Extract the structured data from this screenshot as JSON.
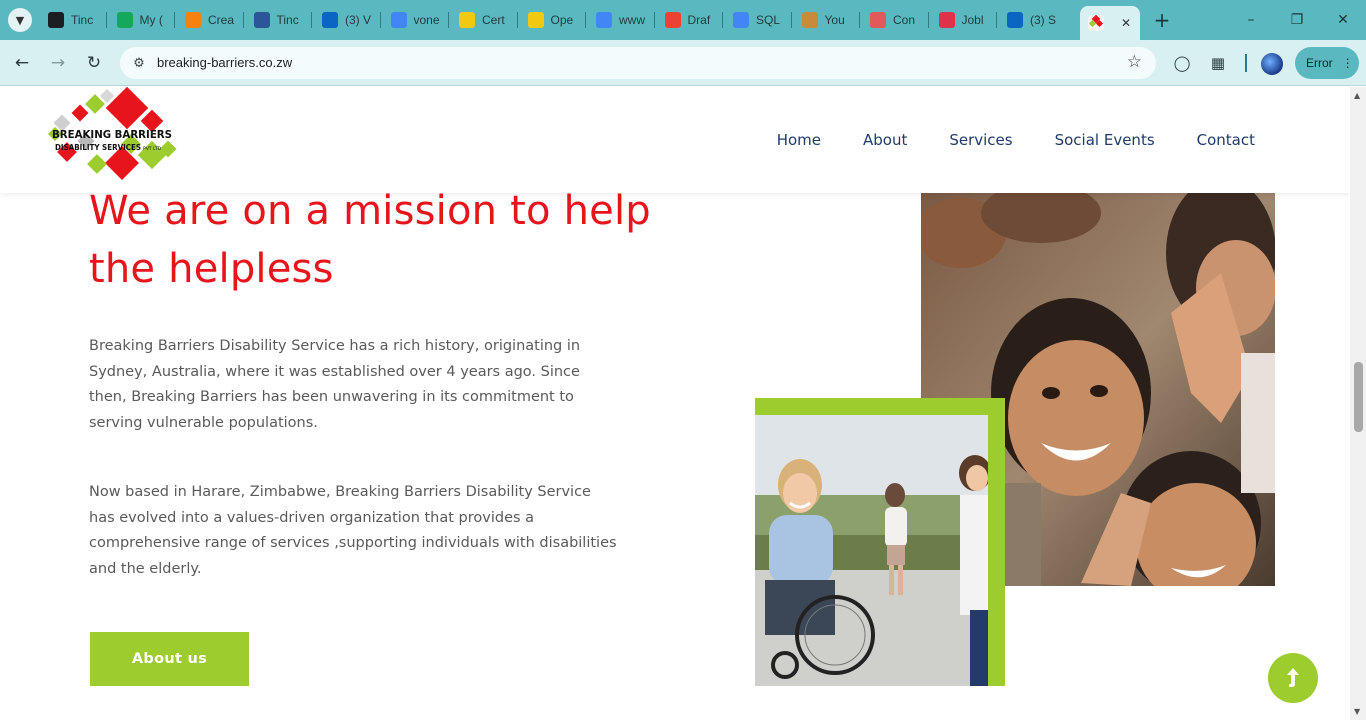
{
  "browser": {
    "tabs": [
      {
        "label": "Tinc",
        "icon": "github-icon",
        "color": "#1b1f23"
      },
      {
        "label": "My (",
        "icon": "grammarly-icon",
        "color": "#15a85a"
      },
      {
        "label": "Crea",
        "icon": "firebase-icon",
        "color": "#f5820d"
      },
      {
        "label": "Tinc",
        "icon": "document-icon",
        "color": "#2b5797"
      },
      {
        "label": "(3) V",
        "icon": "linkedin-icon",
        "color": "#0a66c2"
      },
      {
        "label": "vone",
        "icon": "google-icon",
        "color": "#4285f4"
      },
      {
        "label": "Cert",
        "icon": "notebook-icon",
        "color": "#f2c811"
      },
      {
        "label": "Ope",
        "icon": "notebook-icon",
        "color": "#f2c811"
      },
      {
        "label": "www",
        "icon": "google-icon",
        "color": "#4285f4"
      },
      {
        "label": "Draf",
        "icon": "gmail-icon",
        "color": "#ea4335"
      },
      {
        "label": "SQL",
        "icon": "google-icon",
        "color": "#4285f4"
      },
      {
        "label": "You",
        "icon": "owl-icon",
        "color": "#c98a3a"
      },
      {
        "label": "Con",
        "icon": "loading-icon",
        "color": "#e05a5a"
      },
      {
        "label": "Jobl",
        "icon": "jobs-icon",
        "color": "#e0314b"
      },
      {
        "label": "(3) S",
        "icon": "linkedin-icon",
        "color": "#0a66c2"
      }
    ],
    "url": "breaking-barriers.co.zw",
    "error_label": "Error"
  },
  "site": {
    "logo": {
      "line1": "BREAKING BARRIERS",
      "line2": "DISABILITY SERVICES",
      "suffix": "PVT LTD"
    },
    "nav": [
      "Home",
      "About",
      "Services",
      "Social Events",
      "Contact"
    ],
    "headline": "We are on a mission to help the helpless",
    "paragraph1": "Breaking Barriers Disability Service has a rich history, originating in Sydney, Australia, where it was established over 4 years ago. Since then, Breaking Barriers has been unwavering in its commitment to serving vulnerable populations.",
    "paragraph2": "Now based in Harare, Zimbabwe, Breaking Barriers Disability Service has evolved into a values-driven organization that provides a comprehensive range of services ,supporting individuals with disabilities and the elderly.",
    "button": "About us"
  },
  "colors": {
    "accent_red": "#e8141b",
    "accent_green": "#9ccc2e",
    "nav_text": "#1f3a6b",
    "browser_teal": "#5ab9c0"
  }
}
